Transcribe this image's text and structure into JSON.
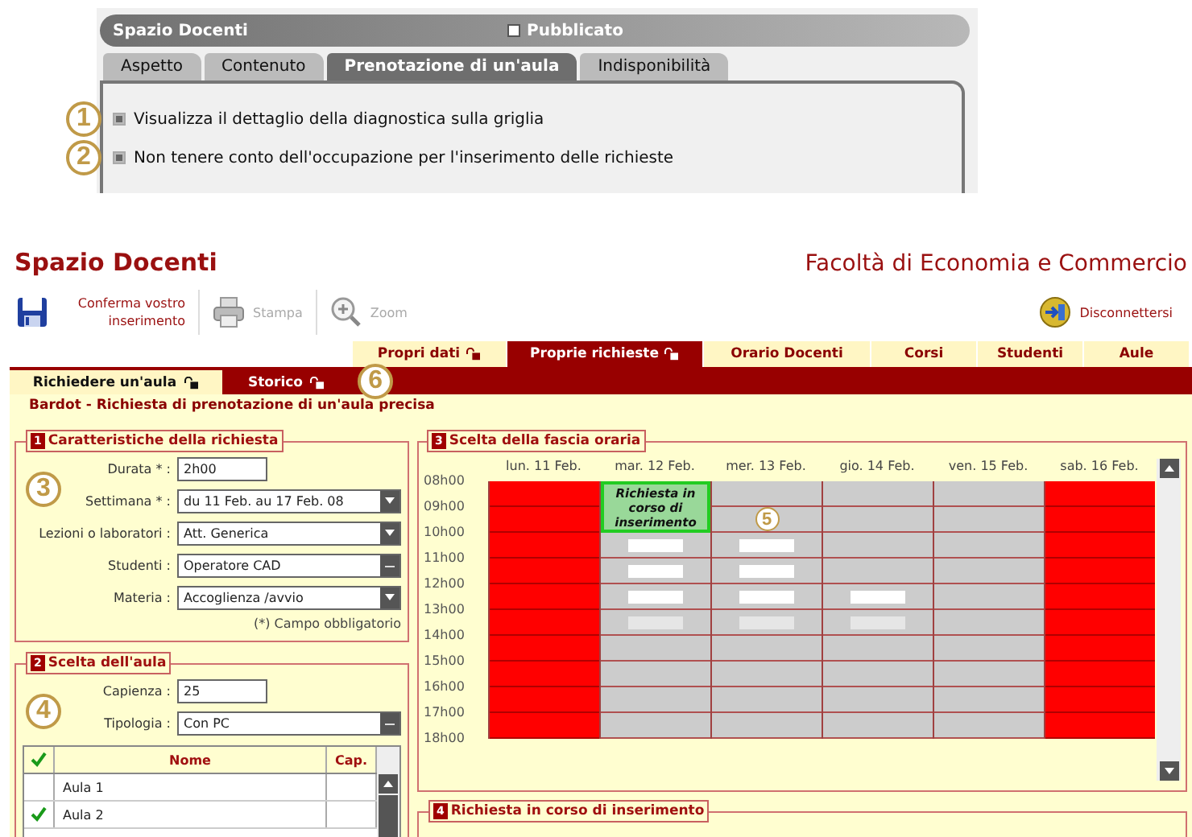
{
  "settings_panel": {
    "title": "Spazio Docenti",
    "published": {
      "label": "Pubblicato",
      "checked": false
    },
    "tabs": [
      {
        "label": "Aspetto",
        "selected": false
      },
      {
        "label": "Contenuto",
        "selected": false
      },
      {
        "label": "Prenotazione di un'aula",
        "selected": true
      },
      {
        "label": "Indisponibilità",
        "selected": false
      }
    ],
    "options": [
      {
        "callout": "1",
        "label": "Visualizza il dettaglio della diagnostica sulla griglia",
        "checked": true
      },
      {
        "callout": "2",
        "label": "Non tenere conto dell'occupazione per l'inserimento delle richieste",
        "checked": true
      }
    ]
  },
  "header": {
    "title": "Spazio Docenti",
    "faculty": "Facoltà di Economia e Commercio"
  },
  "toolbar": [
    {
      "kind": "save",
      "label": "Conferma vostro inserimento",
      "disabled": false
    },
    {
      "kind": "print",
      "label": "Stampa",
      "disabled": true
    },
    {
      "kind": "zoom",
      "label": "Zoom",
      "disabled": true
    },
    {
      "kind": "logout",
      "label": "Disconnettersi",
      "disabled": false
    }
  ],
  "main_tabs": [
    {
      "label": "Propri dati",
      "selected": false,
      "lock": true
    },
    {
      "label": "Proprie richieste",
      "selected": true,
      "lock": true
    },
    {
      "label": "Orario Docenti",
      "selected": false,
      "lock": false
    },
    {
      "label": "Corsi",
      "selected": false,
      "lock": false
    },
    {
      "label": "Studenti",
      "selected": false,
      "lock": false
    },
    {
      "label": "Aule",
      "selected": false,
      "lock": false
    }
  ],
  "sub_tabs": {
    "callout": "6",
    "items": [
      {
        "label": "Richiedere un'aula",
        "selected": true,
        "lock": true
      },
      {
        "label": "Storico",
        "selected": false,
        "lock": true
      }
    ]
  },
  "breadcrumb": "Bardot - Richiesta di prenotazione di un'aula precisa",
  "request_section": {
    "number": "1",
    "title": "Caratteristiche della richiesta",
    "callout": "3",
    "fields": [
      {
        "label": "Durata * :",
        "kind": "text",
        "value": "2h00"
      },
      {
        "label": "Settimana * :",
        "kind": "select",
        "value": "du 11 Feb. au 17 Feb. 08"
      },
      {
        "label": "Lezioni o laboratori :",
        "kind": "select",
        "value": "Att. Generica"
      },
      {
        "label": "Studenti :",
        "kind": "picker",
        "value": "Operatore CAD"
      },
      {
        "label": "Materia :",
        "kind": "select",
        "value": "Accoglienza /avvio"
      }
    ],
    "note": "(*) Campo obbligatorio"
  },
  "room_section": {
    "number": "2",
    "title": "Scelta dell'aula",
    "callout": "4",
    "fields": [
      {
        "label": "Capienza :",
        "kind": "text",
        "value": "25"
      },
      {
        "label": "Tipologia :",
        "kind": "picker",
        "value": "Con PC"
      }
    ],
    "table": {
      "columns": [
        "Nome",
        "Cap."
      ],
      "rows": [
        {
          "name": "Aula 1",
          "selected": false
        },
        {
          "name": "Aula 2",
          "selected": true
        }
      ]
    }
  },
  "time_section": {
    "number": "3",
    "title": "Scelta della fascia oraria",
    "callout": "5",
    "hours": [
      "08h00",
      "09h00",
      "10h00",
      "11h00",
      "12h00",
      "13h00",
      "14h00",
      "15h00",
      "16h00",
      "17h00",
      "18h00"
    ],
    "days": [
      {
        "label": "lun. 11 Feb.",
        "cells": [
          {
            "kind": "blocked"
          },
          {
            "kind": "blocked"
          },
          {
            "kind": "blocked"
          },
          {
            "kind": "blocked"
          },
          {
            "kind": "blocked"
          },
          {
            "kind": "blocked"
          },
          {
            "kind": "blocked"
          },
          {
            "kind": "blocked"
          },
          {
            "kind": "blocked"
          },
          {
            "kind": "blocked"
          }
        ]
      },
      {
        "label": "mar. 12 Feb.",
        "request_label": "Richiesta in corso di inserimento",
        "cells": [
          {
            "kind": "request"
          },
          {
            "kind": "request"
          },
          {
            "kind": "free"
          },
          {
            "kind": "free"
          },
          {
            "kind": "free"
          },
          {
            "kind": "faint"
          },
          {
            "kind": "empty"
          },
          {
            "kind": "empty"
          },
          {
            "kind": "empty"
          },
          {
            "kind": "empty"
          }
        ]
      },
      {
        "label": "mer. 13 Feb.",
        "cells": [
          {
            "kind": "empty"
          },
          {
            "kind": "empty"
          },
          {
            "kind": "free"
          },
          {
            "kind": "free"
          },
          {
            "kind": "free"
          },
          {
            "kind": "faint"
          },
          {
            "kind": "empty"
          },
          {
            "kind": "empty"
          },
          {
            "kind": "empty"
          },
          {
            "kind": "empty"
          }
        ]
      },
      {
        "label": "gio. 14 Feb.",
        "cells": [
          {
            "kind": "empty"
          },
          {
            "kind": "empty"
          },
          {
            "kind": "empty"
          },
          {
            "kind": "empty"
          },
          {
            "kind": "free"
          },
          {
            "kind": "faint"
          },
          {
            "kind": "empty"
          },
          {
            "kind": "empty"
          },
          {
            "kind": "empty"
          },
          {
            "kind": "empty"
          }
        ]
      },
      {
        "label": "ven. 15 Feb.",
        "cells": [
          {
            "kind": "empty"
          },
          {
            "kind": "empty"
          },
          {
            "kind": "empty"
          },
          {
            "kind": "empty"
          },
          {
            "kind": "empty"
          },
          {
            "kind": "empty"
          },
          {
            "kind": "empty"
          },
          {
            "kind": "empty"
          },
          {
            "kind": "empty"
          },
          {
            "kind": "empty"
          }
        ]
      },
      {
        "label": "sab. 16 Feb.",
        "cells": [
          {
            "kind": "blocked"
          },
          {
            "kind": "blocked"
          },
          {
            "kind": "blocked"
          },
          {
            "kind": "blocked"
          },
          {
            "kind": "blocked"
          },
          {
            "kind": "blocked"
          },
          {
            "kind": "blocked"
          },
          {
            "kind": "blocked"
          },
          {
            "kind": "blocked"
          },
          {
            "kind": "blocked"
          }
        ]
      }
    ]
  },
  "summary_section": {
    "number": "4",
    "title": "Richiesta in corso di inserimento"
  }
}
